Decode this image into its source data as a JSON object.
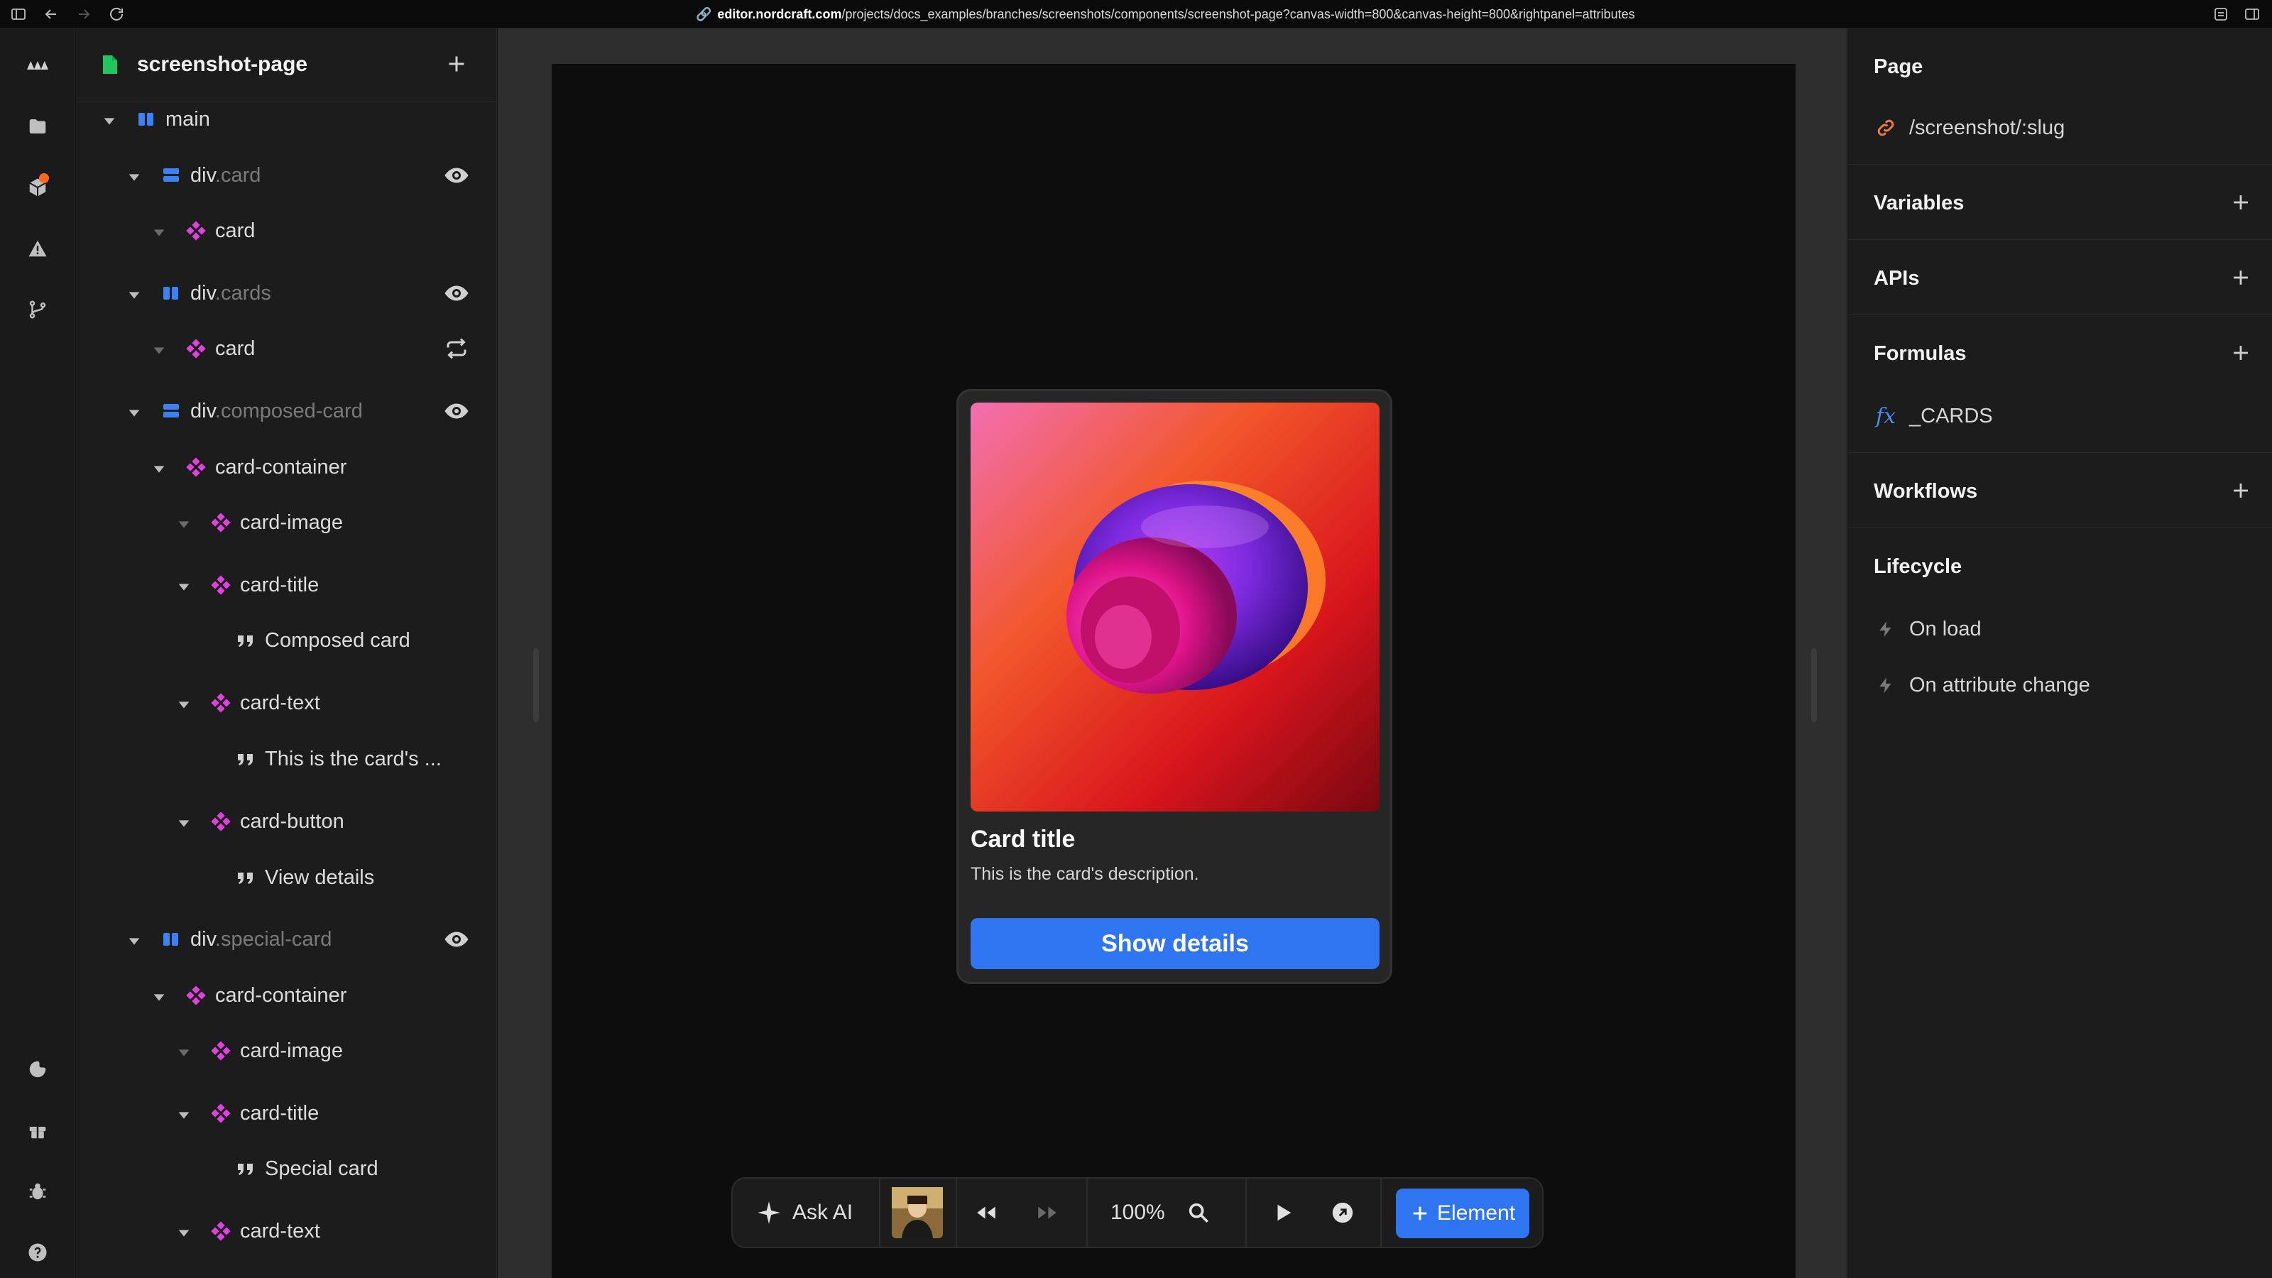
{
  "browser": {
    "url_host": "editor.nordcraft.com",
    "url_path": "/projects/docs_examples/branches/screenshots/components/screenshot-page?canvas-width=800&canvas-height=800&rightpanel=attributes"
  },
  "tree": {
    "page_name": "screenshot-page",
    "nodes": [
      {
        "tag": "main",
        "cls": ""
      },
      {
        "tag": "div",
        "cls": ".card"
      },
      {
        "tag": "card",
        "cls": ""
      },
      {
        "tag": "div",
        "cls": ".cards"
      },
      {
        "tag": "card",
        "cls": ""
      },
      {
        "tag": "div",
        "cls": ".composed-card"
      },
      {
        "tag": "card-container",
        "cls": ""
      },
      {
        "tag": "card-image",
        "cls": ""
      },
      {
        "tag": "card-title",
        "cls": ""
      },
      {
        "tag": "Composed card",
        "cls": ""
      },
      {
        "tag": "card-text",
        "cls": ""
      },
      {
        "tag": "This is the card's ...",
        "cls": ""
      },
      {
        "tag": "card-button",
        "cls": ""
      },
      {
        "tag": "View details",
        "cls": ""
      },
      {
        "tag": "div",
        "cls": ".special-card"
      },
      {
        "tag": "card-container",
        "cls": ""
      },
      {
        "tag": "card-image",
        "cls": ""
      },
      {
        "tag": "card-title",
        "cls": ""
      },
      {
        "tag": "Special card",
        "cls": ""
      },
      {
        "tag": "card-text",
        "cls": ""
      }
    ]
  },
  "canvas": {
    "card_title": "Card title",
    "card_description": "This is the card's description.",
    "card_button": "Show details"
  },
  "toolbar": {
    "ask_ai": "Ask AI",
    "zoom": "100%",
    "element_button": "Element"
  },
  "right_panel": {
    "page_title": "Page",
    "route": "/screenshot/:slug",
    "variables": "Variables",
    "apis": "APIs",
    "formulas": "Formulas",
    "formula_item": "_CARDS",
    "workflows": "Workflows",
    "lifecycle": "Lifecycle",
    "on_load": "On load",
    "on_attribute_change": "On attribute change"
  },
  "colors": {
    "accent_blue": "#2f74f0",
    "component_magenta": "#e040e0",
    "element_blue": "#3b82f6",
    "file_green": "#22c55e",
    "link_orange": "#f07a3a"
  }
}
